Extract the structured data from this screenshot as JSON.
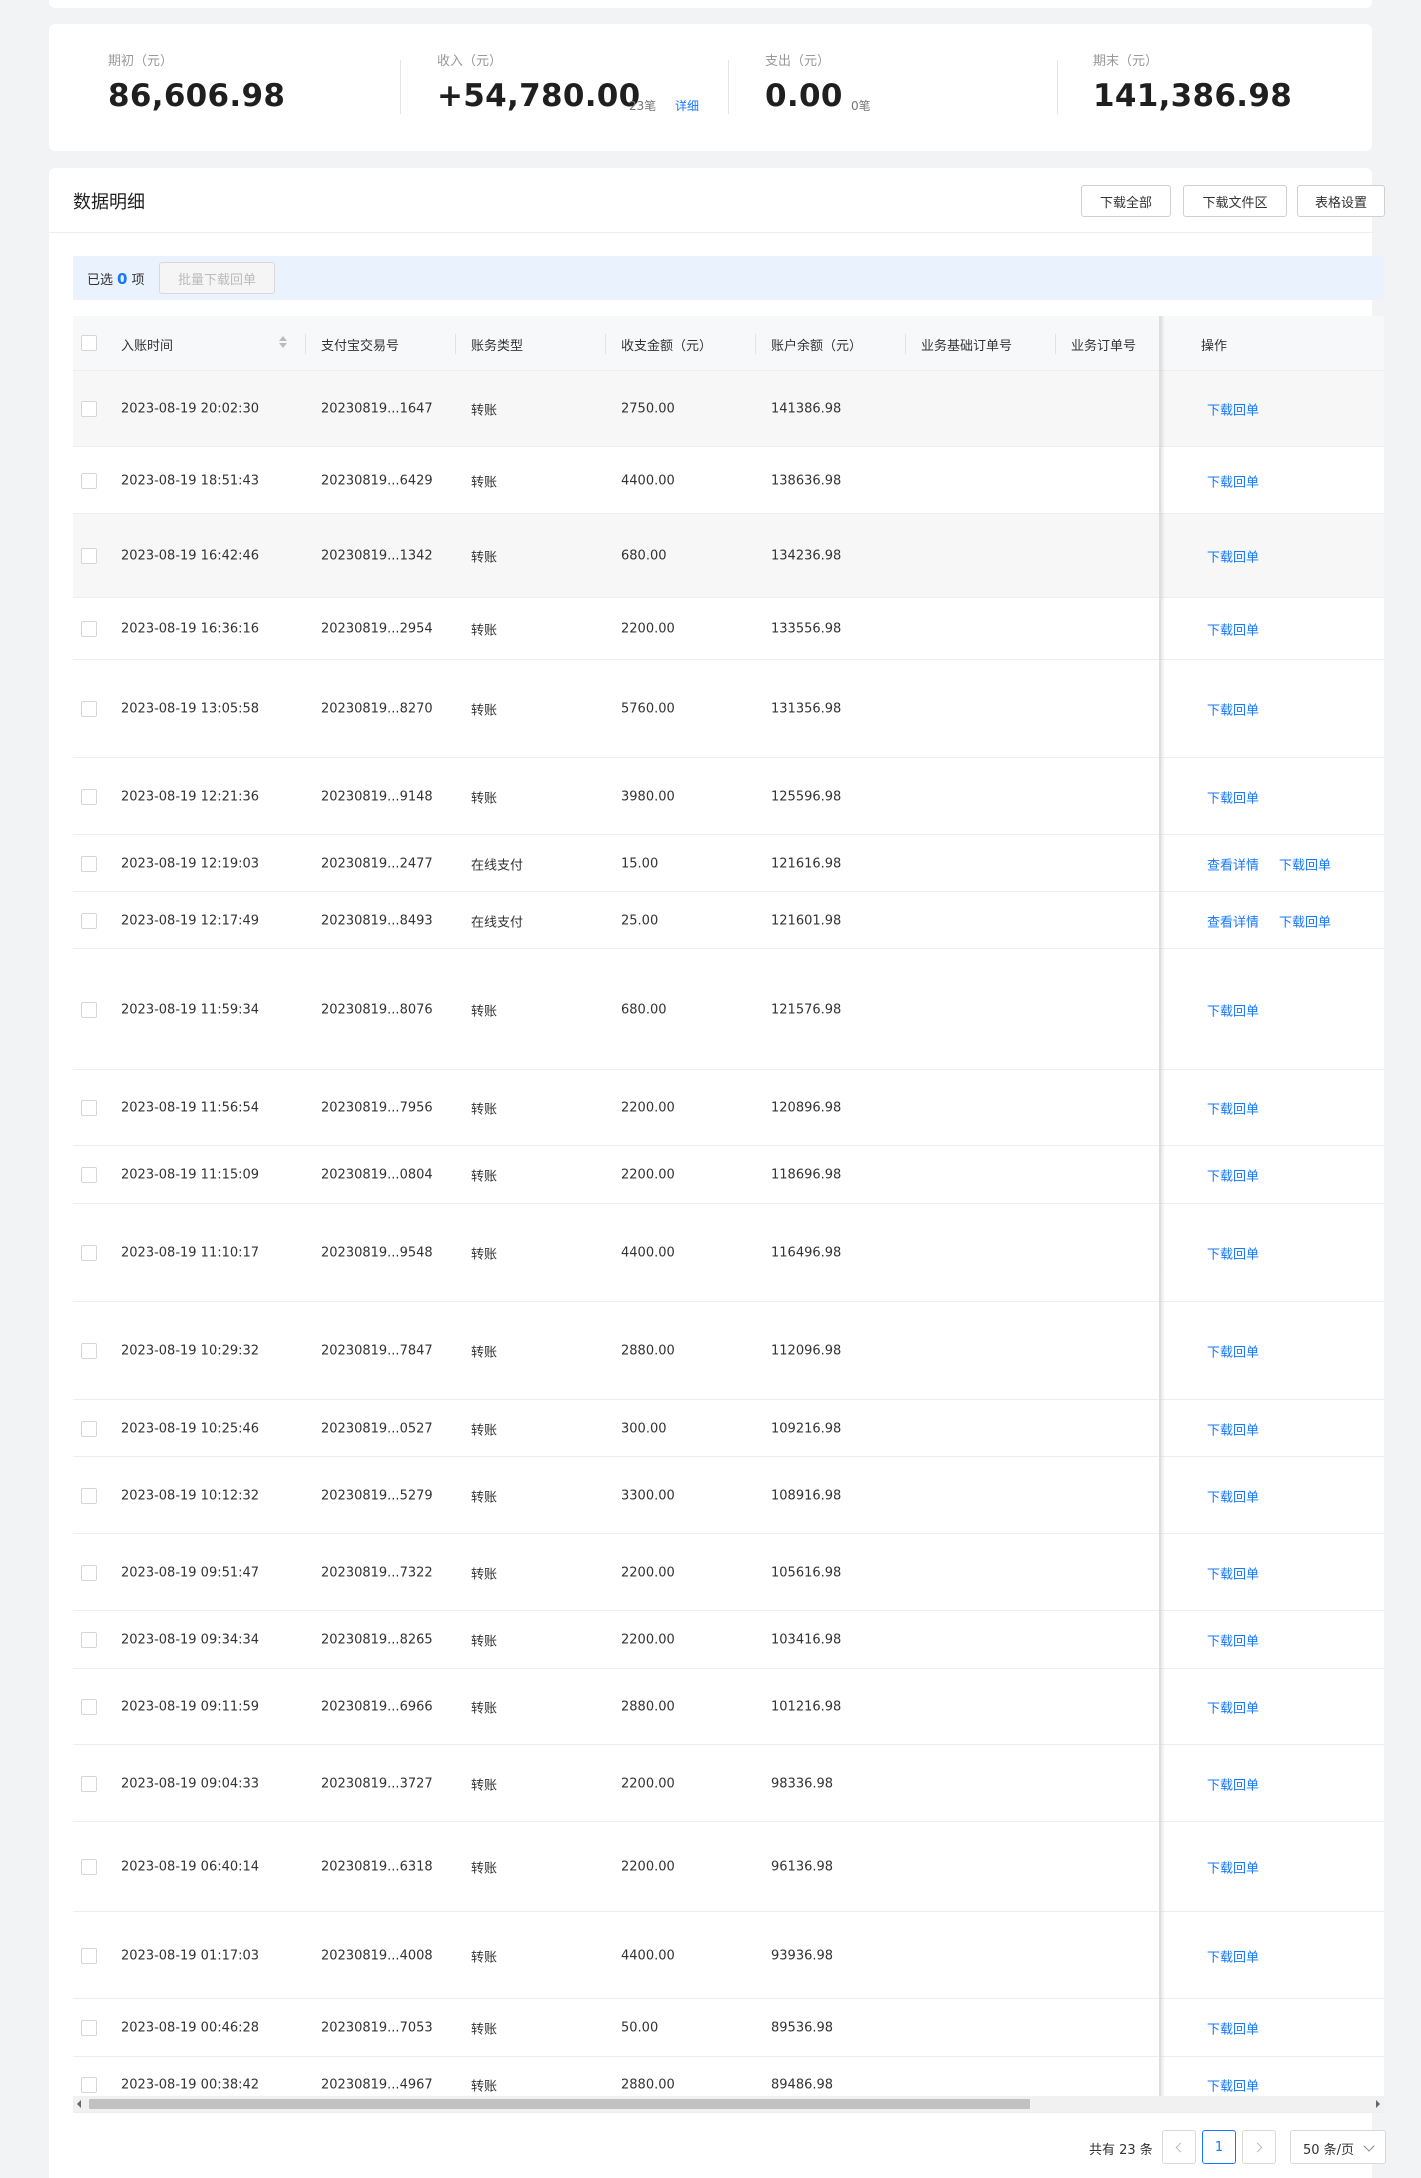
{
  "summary": {
    "opening": {
      "label": "期初（元）",
      "value": "86,606.98"
    },
    "income": {
      "label": "收入（元）",
      "value": "+54,780.00",
      "count": "23笔",
      "detail_link": "详细"
    },
    "expense": {
      "label": "支出（元）",
      "value": "0.00",
      "count": "0笔"
    },
    "closing": {
      "label": "期末（元）",
      "value": "141,386.98"
    }
  },
  "panel": {
    "title": "数据明细",
    "buttons": {
      "download_all": "下载全部",
      "download_files": "下载文件区",
      "table_settings": "表格设置"
    }
  },
  "selection": {
    "prefix": "已选",
    "count": "0",
    "suffix": "项",
    "batch_button": "批量下载回单"
  },
  "table": {
    "columns": {
      "time": "入账时间",
      "trade_no": "支付宝交易号",
      "account_type": "账务类型",
      "amount": "收支金额（元）",
      "balance": "账户余额（元）",
      "base_order": "业务基础订单号",
      "biz_order": "业务订单号",
      "actions": "操作"
    },
    "action_labels": {
      "download": "下载回单",
      "view": "查看详情"
    },
    "rows": [
      {
        "time": "2023-08-19 20:02:30",
        "trade_no": "20230819...1647",
        "type": "转账",
        "amount": "2750.00",
        "balance": "141386.98"
      },
      {
        "time": "2023-08-19 18:51:43",
        "trade_no": "20230819...6429",
        "type": "转账",
        "amount": "4400.00",
        "balance": "138636.98"
      },
      {
        "time": "2023-08-19 16:42:46",
        "trade_no": "20230819...1342",
        "type": "转账",
        "amount": "680.00",
        "balance": "134236.98"
      },
      {
        "time": "2023-08-19 16:36:16",
        "trade_no": "20230819...2954",
        "type": "转账",
        "amount": "2200.00",
        "balance": "133556.98"
      },
      {
        "time": "2023-08-19 13:05:58",
        "trade_no": "20230819...8270",
        "type": "转账",
        "amount": "5760.00",
        "balance": "131356.98"
      },
      {
        "time": "2023-08-19 12:21:36",
        "trade_no": "20230819...9148",
        "type": "转账",
        "amount": "3980.00",
        "balance": "125596.98"
      },
      {
        "time": "2023-08-19 12:19:03",
        "trade_no": "20230819...2477",
        "type": "在线支付",
        "amount": "15.00",
        "balance": "121616.98"
      },
      {
        "time": "2023-08-19 12:17:49",
        "trade_no": "20230819...8493",
        "type": "在线支付",
        "amount": "25.00",
        "balance": "121601.98"
      },
      {
        "time": "2023-08-19 11:59:34",
        "trade_no": "20230819...8076",
        "type": "转账",
        "amount": "680.00",
        "balance": "121576.98"
      },
      {
        "time": "2023-08-19 11:56:54",
        "trade_no": "20230819...7956",
        "type": "转账",
        "amount": "2200.00",
        "balance": "120896.98"
      },
      {
        "time": "2023-08-19 11:15:09",
        "trade_no": "20230819...0804",
        "type": "转账",
        "amount": "2200.00",
        "balance": "118696.98"
      },
      {
        "time": "2023-08-19 11:10:17",
        "trade_no": "20230819...9548",
        "type": "转账",
        "amount": "4400.00",
        "balance": "116496.98"
      },
      {
        "time": "2023-08-19 10:29:32",
        "trade_no": "20230819...7847",
        "type": "转账",
        "amount": "2880.00",
        "balance": "112096.98"
      },
      {
        "time": "2023-08-19 10:25:46",
        "trade_no": "20230819...0527",
        "type": "转账",
        "amount": "300.00",
        "balance": "109216.98"
      },
      {
        "time": "2023-08-19 10:12:32",
        "trade_no": "20230819...5279",
        "type": "转账",
        "amount": "3300.00",
        "balance": "108916.98"
      },
      {
        "time": "2023-08-19 09:51:47",
        "trade_no": "20230819...7322",
        "type": "转账",
        "amount": "2200.00",
        "balance": "105616.98"
      },
      {
        "time": "2023-08-19 09:34:34",
        "trade_no": "20230819...8265",
        "type": "转账",
        "amount": "2200.00",
        "balance": "103416.98"
      },
      {
        "time": "2023-08-19 09:11:59",
        "trade_no": "20230819...6966",
        "type": "转账",
        "amount": "2880.00",
        "balance": "101216.98"
      },
      {
        "time": "2023-08-19 09:04:33",
        "trade_no": "20230819...3727",
        "type": "转账",
        "amount": "2200.00",
        "balance": "98336.98"
      },
      {
        "time": "2023-08-19 06:40:14",
        "trade_no": "20230819...6318",
        "type": "转账",
        "amount": "2200.00",
        "balance": "96136.98"
      },
      {
        "time": "2023-08-19 01:17:03",
        "trade_no": "20230819...4008",
        "type": "转账",
        "amount": "4400.00",
        "balance": "93936.98"
      },
      {
        "time": "2023-08-19 00:46:28",
        "trade_no": "20230819...7053",
        "type": "转账",
        "amount": "50.00",
        "balance": "89536.98"
      },
      {
        "time": "2023-08-19 00:38:42",
        "trade_no": "20230819...4967",
        "type": "转账",
        "amount": "2880.00",
        "balance": "89486.98"
      }
    ]
  },
  "pagination": {
    "total": "共有 23 条",
    "current_page": "1",
    "page_size": "50 条/页"
  },
  "colors": {
    "accent": "#1677ff",
    "page_bg": "#f2f3f5",
    "selection_bg": "#eaf2fe"
  }
}
